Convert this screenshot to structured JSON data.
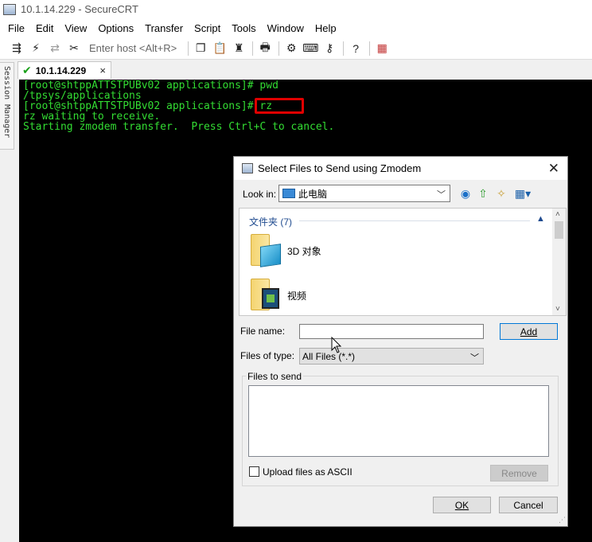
{
  "window": {
    "title": "10.1.14.229 - SecureCRT"
  },
  "menu": [
    "File",
    "Edit",
    "View",
    "Options",
    "Transfer",
    "Script",
    "Tools",
    "Window",
    "Help"
  ],
  "toolbar": {
    "host_placeholder": "Enter host <Alt+R>",
    "icons_left": [
      "connect-icon",
      "lightning-icon",
      "reconnect-icon",
      "disconnect-icon"
    ],
    "icons_right": [
      "copy-icon",
      "paste-icon",
      "find-icon",
      "print-icon",
      "settings-icon",
      "keymap-icon",
      "key-icon",
      "help-icon",
      "sftp-icon"
    ]
  },
  "session_manager": {
    "label": "Session Manager"
  },
  "tab": {
    "label": "10.1.14.229",
    "close": "×"
  },
  "terminal": {
    "lines": [
      "[root@shtppATTSTPUBv02 applications]# pwd",
      "/tpsys/applications",
      "[root@shtppATTSTPUBv02 applications]# rz",
      "rz waiting to receive.",
      "Starting zmodem transfer.  Press Ctrl+C to cancel."
    ]
  },
  "dialog": {
    "title": "Select Files to Send using Zmodem",
    "look_in_label": "Look in:",
    "look_in_value": "此电脑",
    "group_header": "文件夹 (7)",
    "files": [
      {
        "name": "3D 对象",
        "icon": "3d-objects-folder-icon"
      },
      {
        "name": "视频",
        "icon": "videos-folder-icon"
      }
    ],
    "file_name_label": "File name:",
    "file_name_value": "",
    "add_button": "Add",
    "files_of_type_label": "Files of type:",
    "files_of_type_value": "All Files (*.*)",
    "files_to_send_label": "Files to send",
    "upload_ascii_label": "Upload files as ASCII",
    "remove_button": "Remove",
    "ok_button": "OK",
    "cancel_button": "Cancel"
  },
  "colors": {
    "terminal_bg": "#000000",
    "terminal_fg": "#33dd33",
    "highlight": "#e00000"
  }
}
